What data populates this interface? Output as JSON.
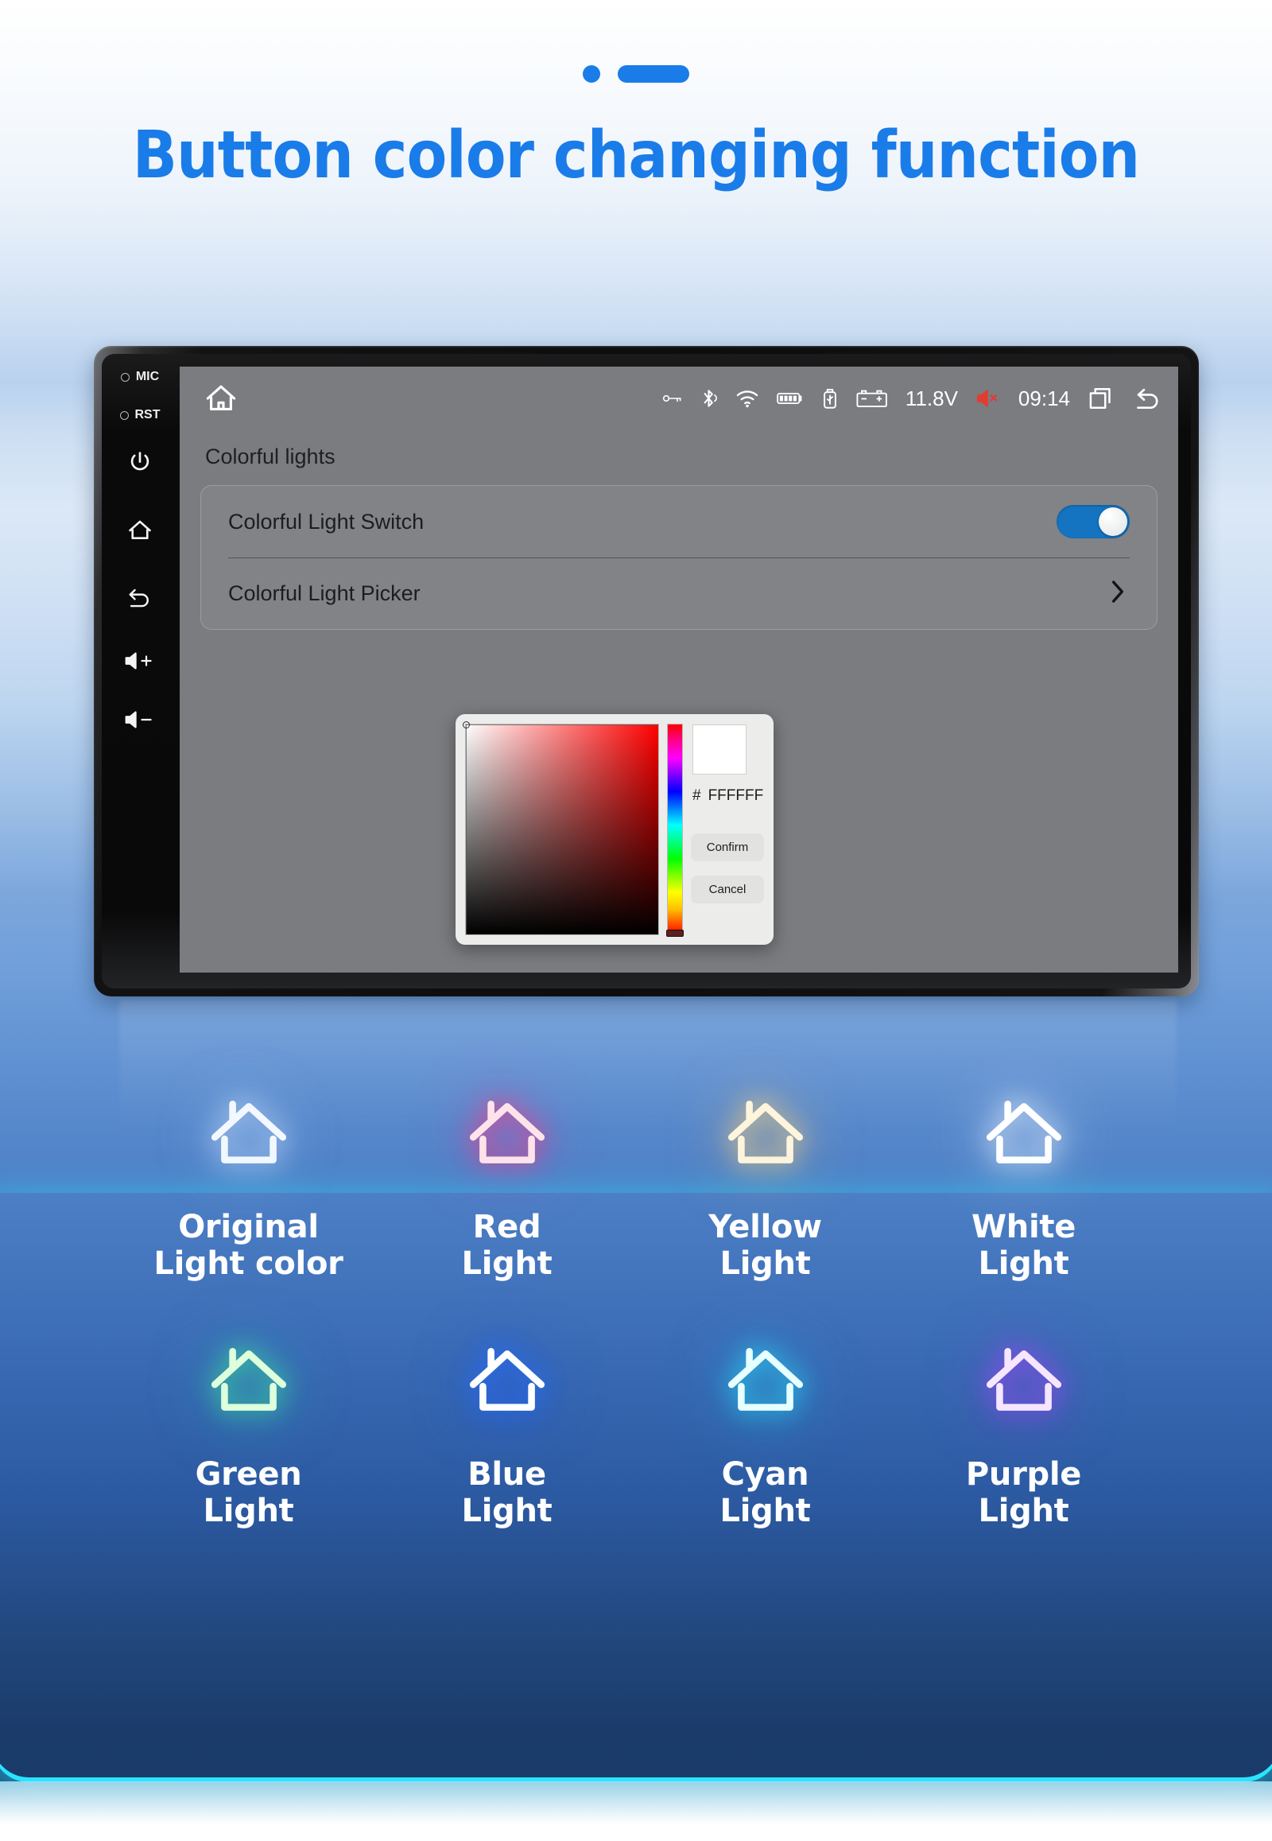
{
  "headline": "Button color changing function",
  "indicator": {
    "dot": "dot-indicator",
    "pill": "pill-indicator"
  },
  "device": {
    "bezel": {
      "mic_label": "MIC",
      "rst_label": "RST",
      "buttons": [
        "power-icon",
        "home-icon",
        "back-icon",
        "volume-up-icon",
        "volume-down-icon"
      ]
    },
    "statusbar": {
      "home_icon": "home-icon",
      "icons": [
        "key-icon",
        "bluetooth-icon",
        "wifi-icon",
        "battery-icon",
        "usb-icon",
        "car-battery-icon"
      ],
      "voltage": "11.8V",
      "mute_icon": "speaker-mute-icon",
      "clock": "09:14",
      "recents_icon": "recent-apps-icon",
      "back_icon": "back-arrow-icon"
    },
    "screen": {
      "page_title": "Colorful lights",
      "rows": [
        {
          "label": "Colorful Light Switch",
          "control": "toggle",
          "toggle_on": true
        },
        {
          "label": "Colorful Light Picker",
          "control": "chevron"
        }
      ]
    },
    "picker": {
      "hash_symbol": "#",
      "hex_value": "FFFFFF",
      "preview_color": "#FFFFFF",
      "confirm_label": "Confirm",
      "cancel_label": "Cancel",
      "hue_selected": "#FF0000"
    }
  },
  "lights": [
    {
      "name": "original-light-color",
      "label": "Original\nLight color",
      "stroke": "#f3f8ff",
      "glow": "rgba(210,230,255,0.85)"
    },
    {
      "name": "red-light",
      "label": "Red\nLight",
      "stroke": "#ffe3ea",
      "glow": "rgba(255,60,130,0.95)"
    },
    {
      "name": "yellow-light",
      "label": "Yellow\nLight",
      "stroke": "#fff4dc",
      "glow": "rgba(255,214,130,0.95)"
    },
    {
      "name": "white-light",
      "label": "White\nLight",
      "stroke": "#ffffff",
      "glow": "rgba(235,245,255,0.98)"
    },
    {
      "name": "green-light",
      "label": "Green\nLight",
      "stroke": "#ddffdc",
      "glow": "rgba(60,240,150,0.95)"
    },
    {
      "name": "blue-light",
      "label": "Blue\nLight",
      "stroke": "#ffffff",
      "glow": "rgba(40,110,255,0.98)"
    },
    {
      "name": "cyan-light",
      "label": "Cyan\nLight",
      "stroke": "#e6ffff",
      "glow": "rgba(40,230,255,0.95)"
    },
    {
      "name": "purple-light",
      "label": "Purple\nLight",
      "stroke": "#f6e6ff",
      "glow": "rgba(170,70,255,0.95)"
    }
  ],
  "colors": {
    "accent": "#1a7ce8",
    "toggle_on": "#1574c1",
    "bottom_glow": "#2ae4ff",
    "screen_bg": "#7a7c80"
  }
}
